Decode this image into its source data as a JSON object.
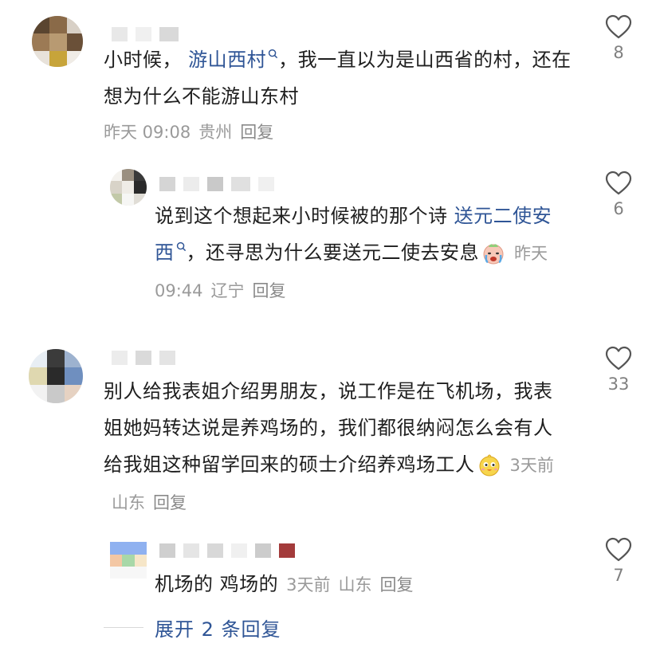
{
  "comments": [
    {
      "text_before": "小时候，",
      "link": "游山西村",
      "text_after": "，我一直以为是山西省的村，还在想为什么不能游山东村",
      "time": "昨天 09:08",
      "location": "贵州",
      "reply": "回复",
      "likes": "8"
    },
    {
      "text_before": "说到这个想起来小时候被的那个诗",
      "link": "送元二使安西",
      "text_after": "，还寻思为什么要送元二使去安息",
      "time": "昨天 09:44",
      "location": "辽宁",
      "reply": "回复",
      "likes": "6",
      "emoji": "crying-face-icon"
    },
    {
      "text": "别人给我表姐介绍男朋友，说工作是在飞机场，我表姐她妈转达说是养鸡场的，我们都很纳闷怎么会有人给我姐这种留学回来的硕士介绍养鸡场工人",
      "time": "3天前",
      "location": "山东",
      "reply": "回复",
      "likes": "33",
      "emoji": "chick-face-icon"
    },
    {
      "text": "机场的 鸡场的",
      "time": "3天前",
      "location": "山东",
      "reply": "回复",
      "likes": "7"
    }
  ],
  "expand_replies": "展开 2 条回复",
  "colors": {
    "link": "#2f5596",
    "meta": "#9a9a9a",
    "text": "#1f1f1f"
  }
}
